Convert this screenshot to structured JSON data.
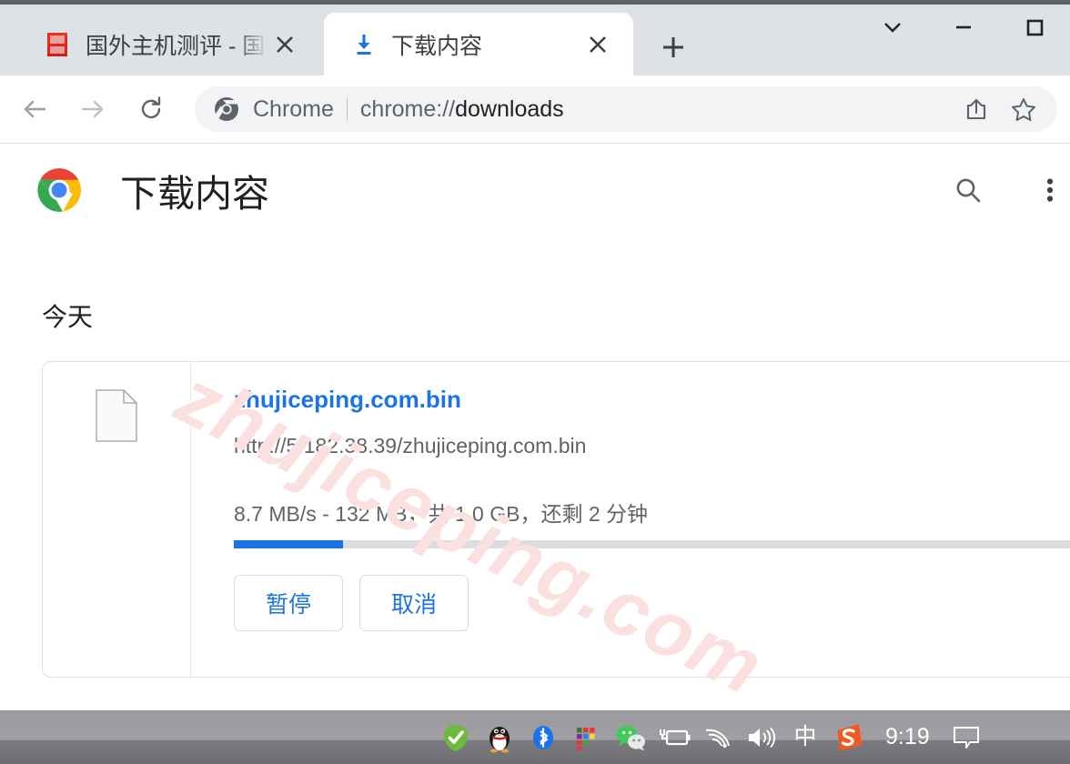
{
  "window": {
    "controls": {
      "tab_search": "chevron-down",
      "minimize": "—",
      "maximize": "□"
    }
  },
  "tabstrip": {
    "tabs": [
      {
        "title": "国外主机测评 - 国外",
        "favicon": "site-favicon-red",
        "active": false,
        "close_label": "×"
      },
      {
        "title": "下载内容",
        "favicon": "download-icon",
        "active": true,
        "close_label": "×"
      }
    ],
    "new_tab_label": "+"
  },
  "toolbar": {
    "back_icon": "arrow-left-icon",
    "forward_icon": "arrow-right-icon",
    "reload_icon": "reload-icon",
    "omnibox": {
      "chip_label": "Chrome",
      "url_scheme": "chrome://",
      "url_path": "downloads",
      "url_full": "chrome://downloads",
      "share_icon": "share-icon",
      "bookmark_icon": "star-icon"
    }
  },
  "page": {
    "title": "下载内容",
    "logo": "chrome-logo",
    "search_icon": "search-icon",
    "menu_icon": "more-vertical-icon",
    "watermark": "zhujiceping.com",
    "day_group": "今天",
    "download": {
      "file_icon": "generic-file-icon",
      "filename": "zhujiceping.com.bin",
      "url": "http://5.182.38.39/zhujiceping.com.bin",
      "status": "8.7 MB/s - 132 MB，共 1.0 GB，还剩 2 分钟",
      "progress_percent": 12.6,
      "buttons": [
        {
          "label": "暂停",
          "name": "pause"
        },
        {
          "label": "取消",
          "name": "cancel"
        }
      ]
    }
  },
  "taskbar": {
    "tray_icons": [
      "security-shield-check-icon",
      "qq-penguin-icon",
      "bluetooth-icon",
      "color-grid-icon",
      "wechat-icon",
      "battery-charging-icon",
      "wifi-icon",
      "volume-icon"
    ],
    "ime_indicator": "中",
    "sogou_icon": "sogou-ime-icon",
    "clock": "9:19",
    "notification_icon": "notification-icon"
  },
  "colors": {
    "accent_blue": "#1a73e8",
    "link_blue": "#1a73e8",
    "tabstrip_bg": "#dee1e6",
    "omnibox_bg": "#f1f3f4",
    "watermark_pink": "#fbe0e0",
    "progress_track": "#dadce0",
    "taskbar_gray": "#9a9a9e"
  }
}
